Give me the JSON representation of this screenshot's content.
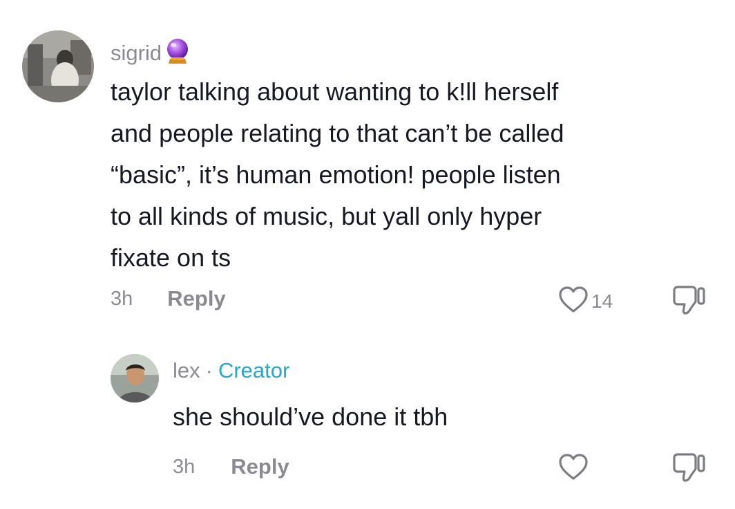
{
  "comment": {
    "username": "sigrid",
    "username_emoji": "crystal-ball-icon",
    "text": "taylor talking about wanting to k!ll herself\nand people relating to that can’t be called\n“basic”, it’s human emotion! people listen\nto all kinds of music, but yall only hyper\nfixate on ts",
    "time": "3h",
    "reply_label": "Reply",
    "like_count": "14"
  },
  "reply": {
    "username": "lex",
    "separator": "·",
    "badge": "Creator",
    "text": "she should’ve done it tbh",
    "time": "3h",
    "reply_label": "Reply"
  },
  "colors": {
    "text": "#161823",
    "muted": "#8a8b91",
    "creator": "#2aa7c9"
  }
}
